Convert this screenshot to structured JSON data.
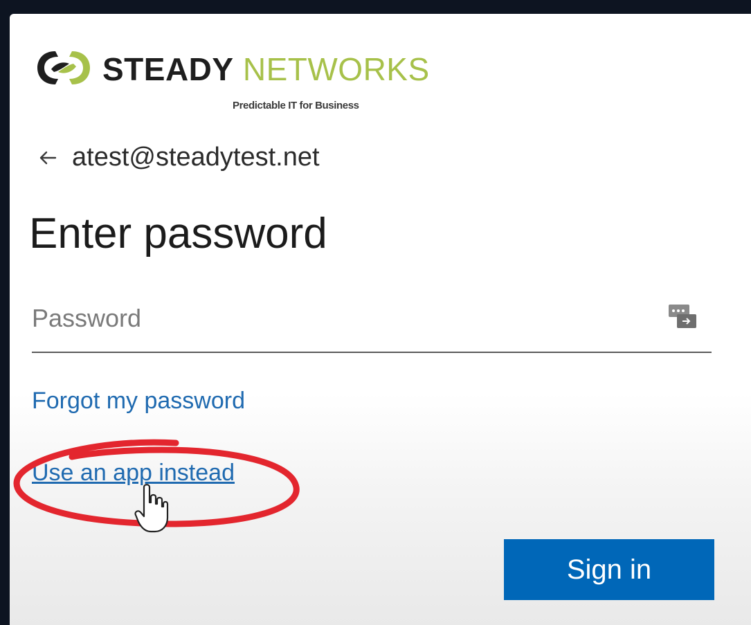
{
  "brand": {
    "word_bold": "STEADY",
    "word_light": "NETWORKS",
    "tagline": "Predictable IT for Business",
    "colors": {
      "accent_green": "#a7c14a",
      "dark": "#1e1e1e"
    }
  },
  "identity": {
    "back_icon": "arrow-left-icon",
    "email": "atest@steadytest.net"
  },
  "title": "Enter password",
  "password": {
    "placeholder": "Password",
    "value": "",
    "reveal_icon": "reveal-password-icon"
  },
  "links": {
    "forgot": "Forgot my password",
    "use_app": "Use an app instead"
  },
  "sign_in": {
    "label": "Sign in",
    "color": "#0067b8"
  },
  "annotation": {
    "color": "#e3262e"
  }
}
